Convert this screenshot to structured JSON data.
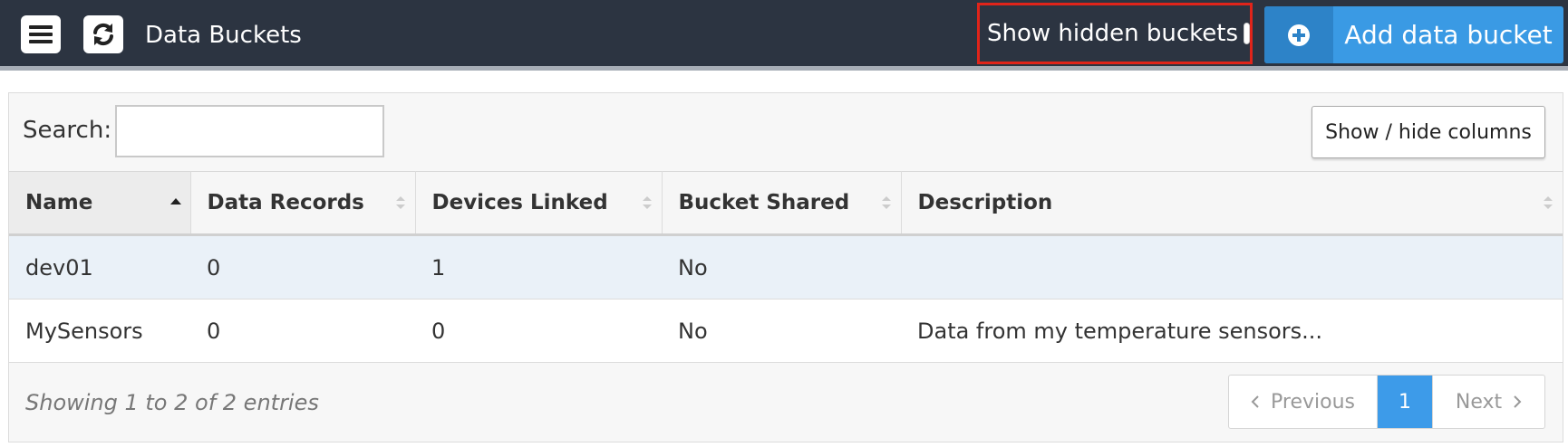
{
  "header": {
    "title": "Data Buckets",
    "menu_icon": "hamburger-menu-icon",
    "refresh_icon": "refresh-icon",
    "show_hidden_label": "Show hidden buckets",
    "show_hidden_checked": false,
    "add_button_label": "Add data bucket",
    "add_icon": "plus-circle-icon"
  },
  "toolbar": {
    "search_label": "Search:",
    "search_value": "",
    "columns_button_label": "Show / hide columns"
  },
  "table": {
    "columns": [
      "Name",
      "Data Records",
      "Devices Linked",
      "Bucket Shared",
      "Description"
    ],
    "sorted_column": "Name",
    "sort_direction": "ascending",
    "rows": [
      {
        "name": "dev01",
        "data_records": "0",
        "devices_linked": "1",
        "bucket_shared": "No",
        "description": ""
      },
      {
        "name": "MySensors",
        "data_records": "0",
        "devices_linked": "0",
        "bucket_shared": "No",
        "description": "Data from my temperature sensors..."
      }
    ]
  },
  "footer": {
    "info": "Showing 1 to 2 of 2 entries",
    "previous_label": "Previous",
    "current_page": "1",
    "next_label": "Next"
  },
  "colors": {
    "header_bg": "#2c3441",
    "accent": "#3a9ae4",
    "highlight_border": "#e0241a",
    "selected_row": "#eaf1f8"
  }
}
